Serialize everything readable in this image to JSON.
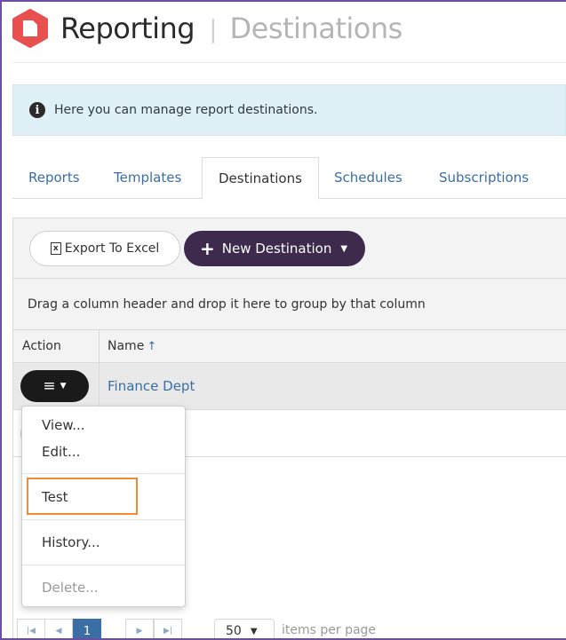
{
  "header": {
    "app_title": "Reporting",
    "separator": "|",
    "section_title": "Destinations",
    "logo_icon": "hexagon-document-icon",
    "logo_color": "#e8504f"
  },
  "alert": {
    "icon": "info-icon",
    "text": "Here you can manage report destinations."
  },
  "tabs": [
    {
      "label": "Reports",
      "active": false
    },
    {
      "label": "Templates",
      "active": false
    },
    {
      "label": "Destinations",
      "active": true
    },
    {
      "label": "Schedules",
      "active": false
    },
    {
      "label": "Subscriptions",
      "active": false
    }
  ],
  "toolbar": {
    "export_label": "Export To Excel",
    "export_icon": "excel-icon",
    "new_label": "New Destination",
    "new_icon": "plus-icon",
    "accent": "#3e2a4d"
  },
  "grid": {
    "group_hint": "Drag a column header and drop it here to group by that column",
    "columns": {
      "action": "Action",
      "name": "Name",
      "sort_icon": "↑"
    },
    "rows": [
      {
        "name": "Finance Dept"
      }
    ]
  },
  "action_menu": {
    "items": [
      {
        "label": "View...",
        "disabled": false
      },
      {
        "label": "Edit...",
        "disabled": false
      },
      {
        "label": "Test",
        "disabled": false,
        "highlighted": true
      },
      {
        "label": "History...",
        "disabled": false
      },
      {
        "label": "Delete...",
        "disabled": true
      }
    ],
    "highlight_color": "#f08a35"
  },
  "pager": {
    "first_icon": "first-page-icon",
    "prev_icon": "prev-page-icon",
    "current_page": "1",
    "next_icon": "next-page-icon",
    "last_icon": "last-page-icon",
    "page_size": "50",
    "per_page_label": "items per page"
  }
}
